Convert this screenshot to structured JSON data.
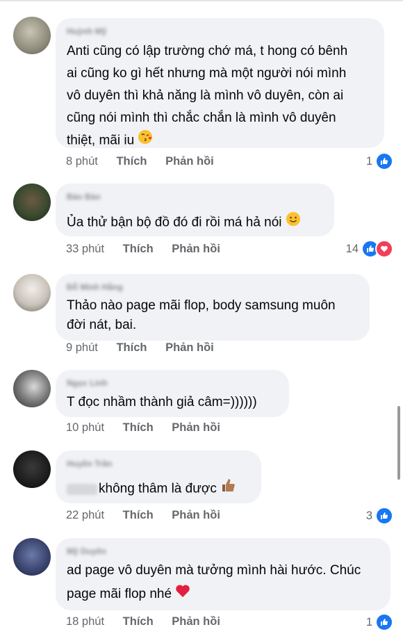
{
  "comments": [
    {
      "name": "Huỳnh Mỹ",
      "lines": [
        "Anti cũng có lập trường chớ má, t hong có bênh",
        "ai cũng ko gì hết nhưng mà một người nói mình",
        "vô duyên thì khả năng là mình vô duyên, còn ai",
        "cũng nói mình thì chắc chắn là mình vô duyên",
        "thiệt, mãi iu"
      ],
      "emoji": "kiss-icon",
      "time": "8 phút",
      "like": "Thích",
      "reply": "Phản hồi",
      "reactions": "1"
    },
    {
      "name": "Bảo Bảo",
      "lines": [
        "Ủa thử bận bộ đồ đó đi rồi má hả nói"
      ],
      "emoji": "smile-icon",
      "time": "33 phút",
      "like": "Thích",
      "reply": "Phản hồi",
      "reactions": "14"
    },
    {
      "name": "Đỗ Minh Hằng",
      "lines": [
        "Thảo nào page mãi flop, body samsung muôn",
        "đời nát, bai."
      ],
      "time": "9 phút",
      "like": "Thích",
      "reply": "Phản hồi",
      "reactions": ""
    },
    {
      "name": "Ngọc Linh",
      "lines": [
        "T đọc nhầm thành giả câm=))))))"
      ],
      "time": "10 phút",
      "like": "Thích",
      "reply": "Phản hồi",
      "reactions": ""
    },
    {
      "name": "Huyền Trân",
      "lines": [
        "không thâm là được"
      ],
      "emoji": "thumbs-up-icon",
      "time": "22 phút",
      "like": "Thích",
      "reply": "Phản hồi",
      "reactions": "3"
    },
    {
      "name": "Mỹ Duyên",
      "lines": [
        "ad page vô duyên mà tưởng mình hài hước. Chúc",
        "page mãi flop nhé"
      ],
      "emoji": "heart-icon",
      "time": "18 phút",
      "like": "Thích",
      "reply": "Phản hồi",
      "reactions": "1"
    }
  ],
  "colors": {
    "bubble": "#f0f2f5",
    "like_blue": "#1877f2",
    "love_red": "#f33e58",
    "meta_gray": "#65676b"
  }
}
